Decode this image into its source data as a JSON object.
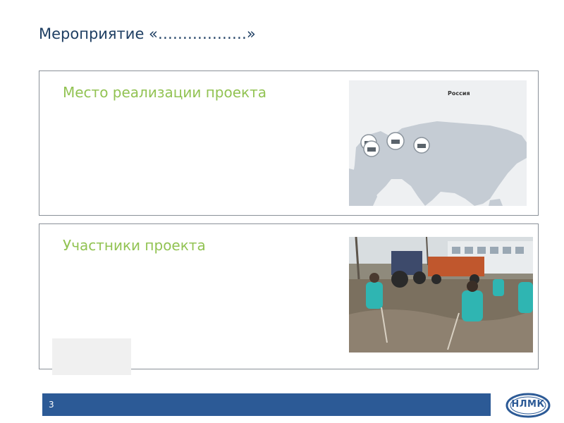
{
  "slide": {
    "title": "Мероприятие «………………»",
    "page_number": "3"
  },
  "panels": {
    "location": {
      "heading": "Место реализации проекта",
      "map_label": "Россия"
    },
    "participants": {
      "heading": "Участники проекта"
    }
  },
  "logo": {
    "text": "НЛМК"
  },
  "colors": {
    "title": "#1f3f63",
    "heading": "#92c353",
    "footer_bar": "#2c5a96"
  }
}
